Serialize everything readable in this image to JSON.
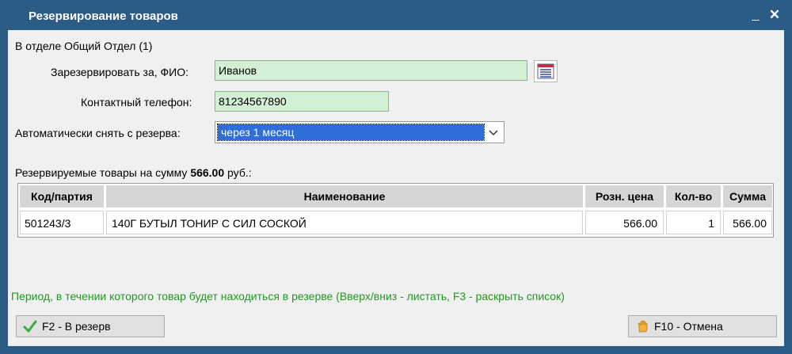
{
  "window": {
    "title": "Резервирование товаров",
    "minimize_label": "_",
    "close_label": "✕"
  },
  "department_line": "В отделе Общий Отдел (1)",
  "form": {
    "reserve_for_label": "Зарезервировать за, ФИО:",
    "reserve_for_value": "Иванов",
    "phone_label": "Контактный телефон:",
    "phone_value": "81234567890",
    "auto_remove_label": "Автоматически снять с резерва:",
    "auto_remove_value": "через 1 месяц"
  },
  "summary": {
    "prefix": "Резервируемые товары на сумму",
    "amount": "566.00",
    "suffix": "руб.:"
  },
  "table": {
    "columns": [
      "Код/партия",
      "Наименование",
      "Розн. цена",
      "Кол-во",
      "Сумма"
    ],
    "rows": [
      [
        "501243/3",
        "140Г БУТЫЛ ТОНИР С СИЛ СОСКОЙ",
        "566.00",
        "1",
        "566.00"
      ]
    ]
  },
  "status_text": "Период, в течении которого товар будет находиться в резерве (Вверх/вниз - листать, F3 - раскрыть список)",
  "buttons": {
    "reserve": "F2 - В резерв",
    "cancel": "F10 - Отмена"
  },
  "icons": {
    "list": "list-icon",
    "check": "checkmark-icon",
    "cancel": "hand-icon"
  },
  "colors": {
    "title_bar": "#2c5b86",
    "field_bg": "#d4f0d4",
    "selection": "#2d6fd6",
    "status_text": "#1e9a1e"
  }
}
